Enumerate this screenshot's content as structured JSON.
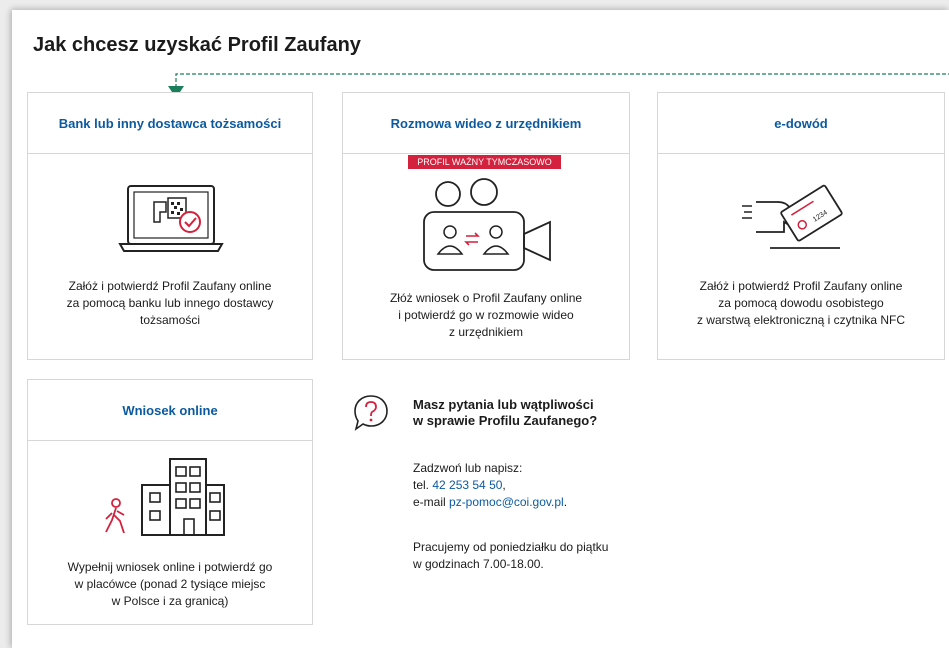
{
  "page_title": "Jak chcesz uzyskać Profil Zaufany",
  "colors": {
    "link": "#0b5a9e",
    "badge": "#d4213d",
    "arrow": "#1a7f5a",
    "accent_icon": "#d4213d"
  },
  "cards": [
    {
      "title": "Bank lub inny dostawca tożsamości",
      "icon": "laptop-identity-check-icon",
      "lines": [
        "Załóż i potwierdź Profil Zaufany online",
        "za pomocą banku lub innego dostawcy",
        "tożsamości"
      ]
    },
    {
      "title": "Rozmowa wideo z urzędnikiem",
      "badge": "PROFIL WAŻNY TYMCZASOWO",
      "icon": "video-call-icon",
      "lines": [
        "Złóż wniosek o Profil Zaufany online",
        "i potwierdź go w rozmowie wideo",
        "z urzędnikiem"
      ]
    },
    {
      "title": "e-dowód",
      "icon": "e-id-card-icon",
      "lines": [
        "Załóż i potwierdź Profil Zaufany online",
        "za pomocą dowodu osobistego",
        "z warstwą elektroniczną i czytnika NFC"
      ]
    },
    {
      "title": "Wniosek online",
      "icon": "office-building-icon",
      "lines": [
        "Wypełnij wniosek online i potwierdź go",
        "w placówce (ponad 2 tysiące miejsc",
        "w Polsce i za granicą)"
      ]
    }
  ],
  "help": {
    "icon": "question-bubble-icon",
    "title_lines": [
      "Masz pytania lub wątpliwości",
      "w sprawie Profilu Zaufanego?"
    ],
    "contact_intro": "Zadzwoń lub napisz:",
    "phone_label": "tel. ",
    "phone": "42 253 54 50",
    "phone_suffix": ",",
    "email_label": "e-mail ",
    "email": "pz-pomoc@coi.gov.pl",
    "email_suffix": ".",
    "hours_lines": [
      "Pracujemy od poniedziałku do piątku",
      "w godzinach 7.00-18.00."
    ]
  },
  "card_icon_text": "1234"
}
